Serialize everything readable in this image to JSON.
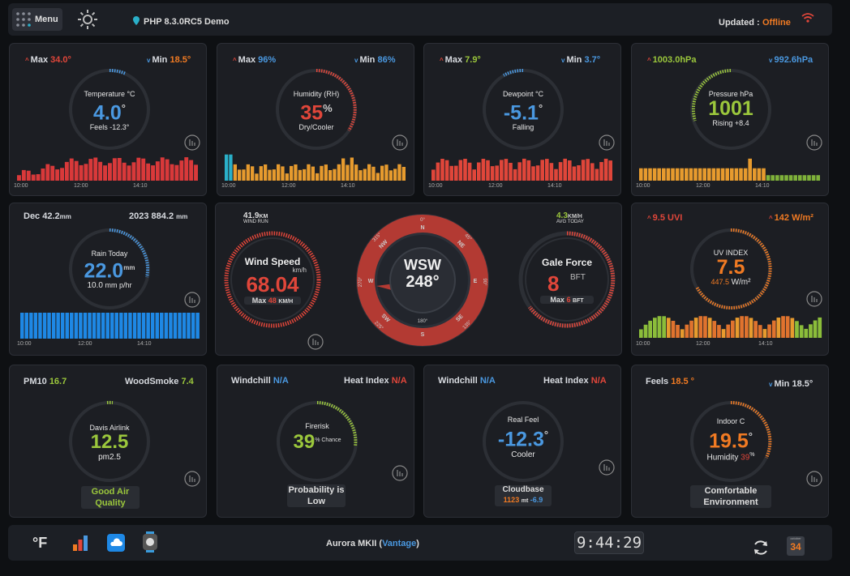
{
  "header": {
    "menu_label": "Menu",
    "site_title": "PHP 8.3.0RC5 Demo",
    "updated_label": "Updated :",
    "updated_status": "Offline"
  },
  "temperature": {
    "max_label": "Max",
    "max_value": "34.0°",
    "min_label": "Min",
    "min_value": "18.5°",
    "title": "Temperature °C",
    "value": "4.0",
    "deg": "°",
    "feels": "Feels -12.3°",
    "t0": "10:00",
    "t1": "12:00",
    "t2": "14:10"
  },
  "humidity": {
    "max_label": "Max",
    "max_value": "96%",
    "min_label": "Min",
    "min_value": "86%",
    "title": "Humidity (RH)",
    "value": "35",
    "unit": "%",
    "desc": "Dry/Cooler",
    "t0": "10:00",
    "t1": "12:00",
    "t2": "14:10"
  },
  "dewpoint": {
    "max_label": "Max",
    "max_value": "7.9°",
    "min_label": "Min",
    "min_value": "3.7°",
    "title": "Dewpoint °C",
    "value": "-5.1",
    "deg": "°",
    "desc": "Falling",
    "t0": "10:00",
    "t1": "12:00",
    "t2": "14:10"
  },
  "pressure": {
    "max_value": "1003.0hPa",
    "min_value": "992.6hPa",
    "title": "Pressure hPa",
    "value": "1001",
    "desc": "Rising +8.4",
    "t0": "10:00",
    "t1": "12:00",
    "t2": "14:10"
  },
  "rain": {
    "month_label": "Dec",
    "month_value": "42.2",
    "month_unit": "mm",
    "year_label": "2023",
    "year_value": "884.2",
    "year_unit": "mm",
    "title": "Rain Today",
    "value": "22.0",
    "unit": "mm",
    "rate": "10.0",
    "rate_unit": "mm p/hr",
    "t0": "10:00",
    "t1": "12:00",
    "t2": "14:10"
  },
  "wind": {
    "run_value": "41.9",
    "run_unit": "KM",
    "run_label": "WIND RUN",
    "speed_title": "Wind Speed",
    "speed_unit": "km/h",
    "speed_value": "68.04",
    "max_label": "Max",
    "max_value": "48",
    "max_unit": "KM/H",
    "direction": "WSW",
    "degrees": "248°",
    "avg_value": "4.3",
    "avg_unit": "KM/H",
    "avg_label": "AVG TODAY",
    "gale_title": "Gale Force",
    "gale_value": "8",
    "gale_unit": "BFT",
    "gale_max_label": "Max",
    "gale_max_value": "6",
    "gale_max_unit": "BFT",
    "compass": {
      "n": "N",
      "s": "S",
      "e": "E",
      "w": "W",
      "ne": "NE",
      "nw": "NW",
      "se": "SE",
      "sw": "SW",
      "d0": "0°",
      "d45": "45°",
      "d90": "90°",
      "d135": "135°",
      "d180": "180°",
      "d225": "225°",
      "d270": "270°",
      "d315": "315°"
    }
  },
  "uv": {
    "uvi_value": "9.5 UVI",
    "solar_value": "142 W/m²",
    "title": "UV INDEX",
    "value": "7.5",
    "solar": "447.5",
    "solar_unit": "W/m²",
    "t0": "10:00",
    "t1": "12:00",
    "t2": "14:10"
  },
  "air": {
    "pm10_label": "PM10",
    "pm10_value": "16.7",
    "smoke_label": "WoodSmoke",
    "smoke_value": "7.4",
    "title": "Davis Airlink",
    "value": "12.5",
    "sub": "pm2.5",
    "quality": "Good Air Quality"
  },
  "firerisk": {
    "windchill_label": "Windchill",
    "windchill_value": "N/A",
    "heat_label": "Heat Index",
    "heat_value": "N/A",
    "title": "Firerisk",
    "value": "39",
    "unit": "% Chance",
    "desc": "Probability is Low"
  },
  "realfeel": {
    "windchill_label": "Windchill",
    "windchill_value": "N/A",
    "heat_label": "Heat Index",
    "heat_value": "N/A",
    "title": "Real Feel",
    "value": "-12.3",
    "deg": "°",
    "desc": "Cooler",
    "cloudbase_label": "Cloudbase",
    "cloudbase_value": "1123",
    "cloudbase_unit": "mt",
    "cloudbase_temp": "-6.9"
  },
  "indoor": {
    "feels_label": "Feels",
    "feels_value": "18.5 °",
    "min_label": "Min",
    "min_value": "18.5°",
    "title": "Indoor C",
    "value": "19.5",
    "deg": "°",
    "humidity_label": "Humidity",
    "humidity_value": "39",
    "humidity_unit": "%",
    "desc": "Comfortable Environment"
  },
  "footer": {
    "unit_label": "°F",
    "station": "Aurora MKII (",
    "station_model": "Vantage",
    "station_close": ")",
    "clock": "9:44:29",
    "calendar_month": "october",
    "calendar_day": "34"
  },
  "colors": {
    "red": "#e0463a",
    "orange": "#f07a23",
    "blue": "#4a98e0",
    "green": "#9bc73c",
    "teal": "#2ab0c9"
  }
}
